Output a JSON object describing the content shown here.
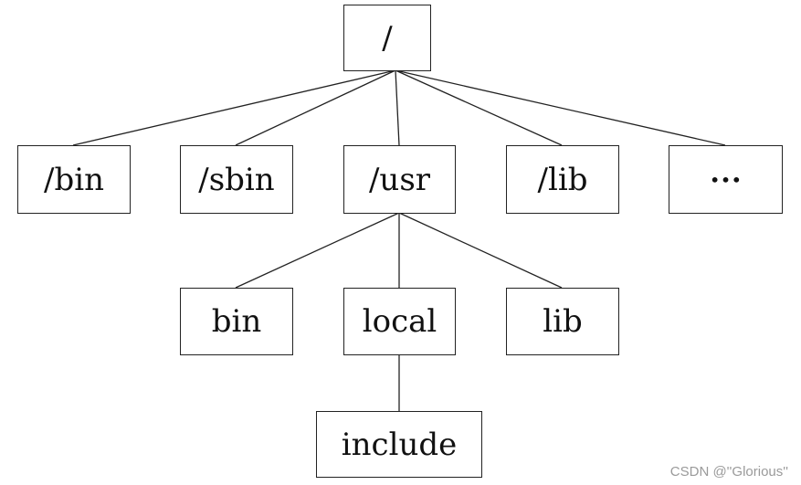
{
  "nodes": {
    "root": "/",
    "bin": "/bin",
    "sbin": "/sbin",
    "usr": "/usr",
    "lib": "/lib",
    "more": "•••",
    "usr_bin": "bin",
    "usr_local": "local",
    "usr_lib": "lib",
    "include": "include"
  },
  "watermark": "CSDN @''Glorious''"
}
